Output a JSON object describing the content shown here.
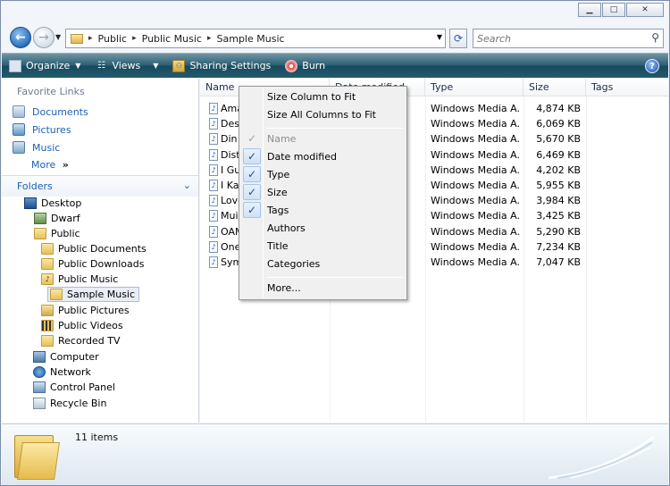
{
  "window": {
    "caption_buttons": [
      "minimize",
      "maximize",
      "close"
    ]
  },
  "address_bar": {
    "crumbs": [
      "Public",
      "Public Music",
      "Sample Music"
    ],
    "search_placeholder": "Search"
  },
  "command_bar": {
    "organize": "Organize",
    "views": "Views",
    "sharing": "Sharing Settings",
    "burn": "Burn",
    "help": "?"
  },
  "favorites": {
    "heading": "Favorite Links",
    "items": [
      {
        "label": "Documents",
        "icon": "documents-icon"
      },
      {
        "label": "Pictures",
        "icon": "pictures-icon"
      },
      {
        "label": "Music",
        "icon": "music-icon"
      }
    ],
    "more": "More",
    "more_arrow": "»"
  },
  "folders": {
    "heading": "Folders",
    "tree": [
      {
        "label": "Desktop",
        "icon": "desktop-icon"
      },
      {
        "label": "Dwarf",
        "icon": "user-folder-icon"
      },
      {
        "label": "Public",
        "icon": "folder-icon"
      },
      {
        "label": "Public Documents",
        "icon": "folder-icon"
      },
      {
        "label": "Public Downloads",
        "icon": "folder-icon"
      },
      {
        "label": "Public Music",
        "icon": "music-folder-icon"
      },
      {
        "label": "Sample Music",
        "icon": "folder-icon"
      },
      {
        "label": "Public Pictures",
        "icon": "pictures-folder-icon"
      },
      {
        "label": "Public Videos",
        "icon": "videos-folder-icon"
      },
      {
        "label": "Recorded TV",
        "icon": "folder-icon"
      },
      {
        "label": "Computer",
        "icon": "computer-icon"
      },
      {
        "label": "Network",
        "icon": "network-icon"
      },
      {
        "label": "Control Panel",
        "icon": "control-panel-icon"
      },
      {
        "label": "Recycle Bin",
        "icon": "recycle-bin-icon"
      }
    ]
  },
  "columns": {
    "name": "Name",
    "date": "Date modified",
    "type": "Type",
    "size": "Size",
    "tags": "Tags"
  },
  "files": [
    {
      "name": "Ama",
      "type": "Windows Media A...",
      "size": "4,874 KB"
    },
    {
      "name": "Desp",
      "type": "Windows Media A...",
      "size": "6,069 KB"
    },
    {
      "name": "Din",
      "type": "Windows Media A...",
      "size": "5,670 KB"
    },
    {
      "name": "Dist",
      "type": "Windows Media A...",
      "size": "6,469 KB"
    },
    {
      "name": "I Gu",
      "type": "Windows Media A...",
      "size": "4,202 KB"
    },
    {
      "name": "I Ka",
      "type": "Windows Media A...",
      "size": "5,955 KB"
    },
    {
      "name": "Love",
      "type": "Windows Media A...",
      "size": "3,984 KB"
    },
    {
      "name": "Mui",
      "type": "Windows Media A...",
      "size": "3,425 KB"
    },
    {
      "name": "OAM",
      "type": "Windows Media A...",
      "size": "5,290 KB"
    },
    {
      "name": "One",
      "type": "Windows Media A...",
      "size": "7,234 KB"
    },
    {
      "name": "Sym",
      "type": "Windows Media A...",
      "size": "7,047 KB"
    }
  ],
  "context_menu": {
    "size_column": "Size Column to Fit",
    "size_all": "Size All Columns to Fit",
    "items": [
      {
        "label": "Name",
        "checked": true,
        "disabled": true
      },
      {
        "label": "Date modified",
        "checked": true,
        "disabled": false
      },
      {
        "label": "Type",
        "checked": true,
        "disabled": false
      },
      {
        "label": "Size",
        "checked": true,
        "disabled": false
      },
      {
        "label": "Tags",
        "checked": true,
        "disabled": false
      },
      {
        "label": "Authors",
        "checked": false,
        "disabled": false
      },
      {
        "label": "Title",
        "checked": false,
        "disabled": false
      },
      {
        "label": "Categories",
        "checked": false,
        "disabled": false
      }
    ],
    "more": "More...",
    "check_glyph": "✓"
  },
  "details": {
    "count": "11 items"
  }
}
